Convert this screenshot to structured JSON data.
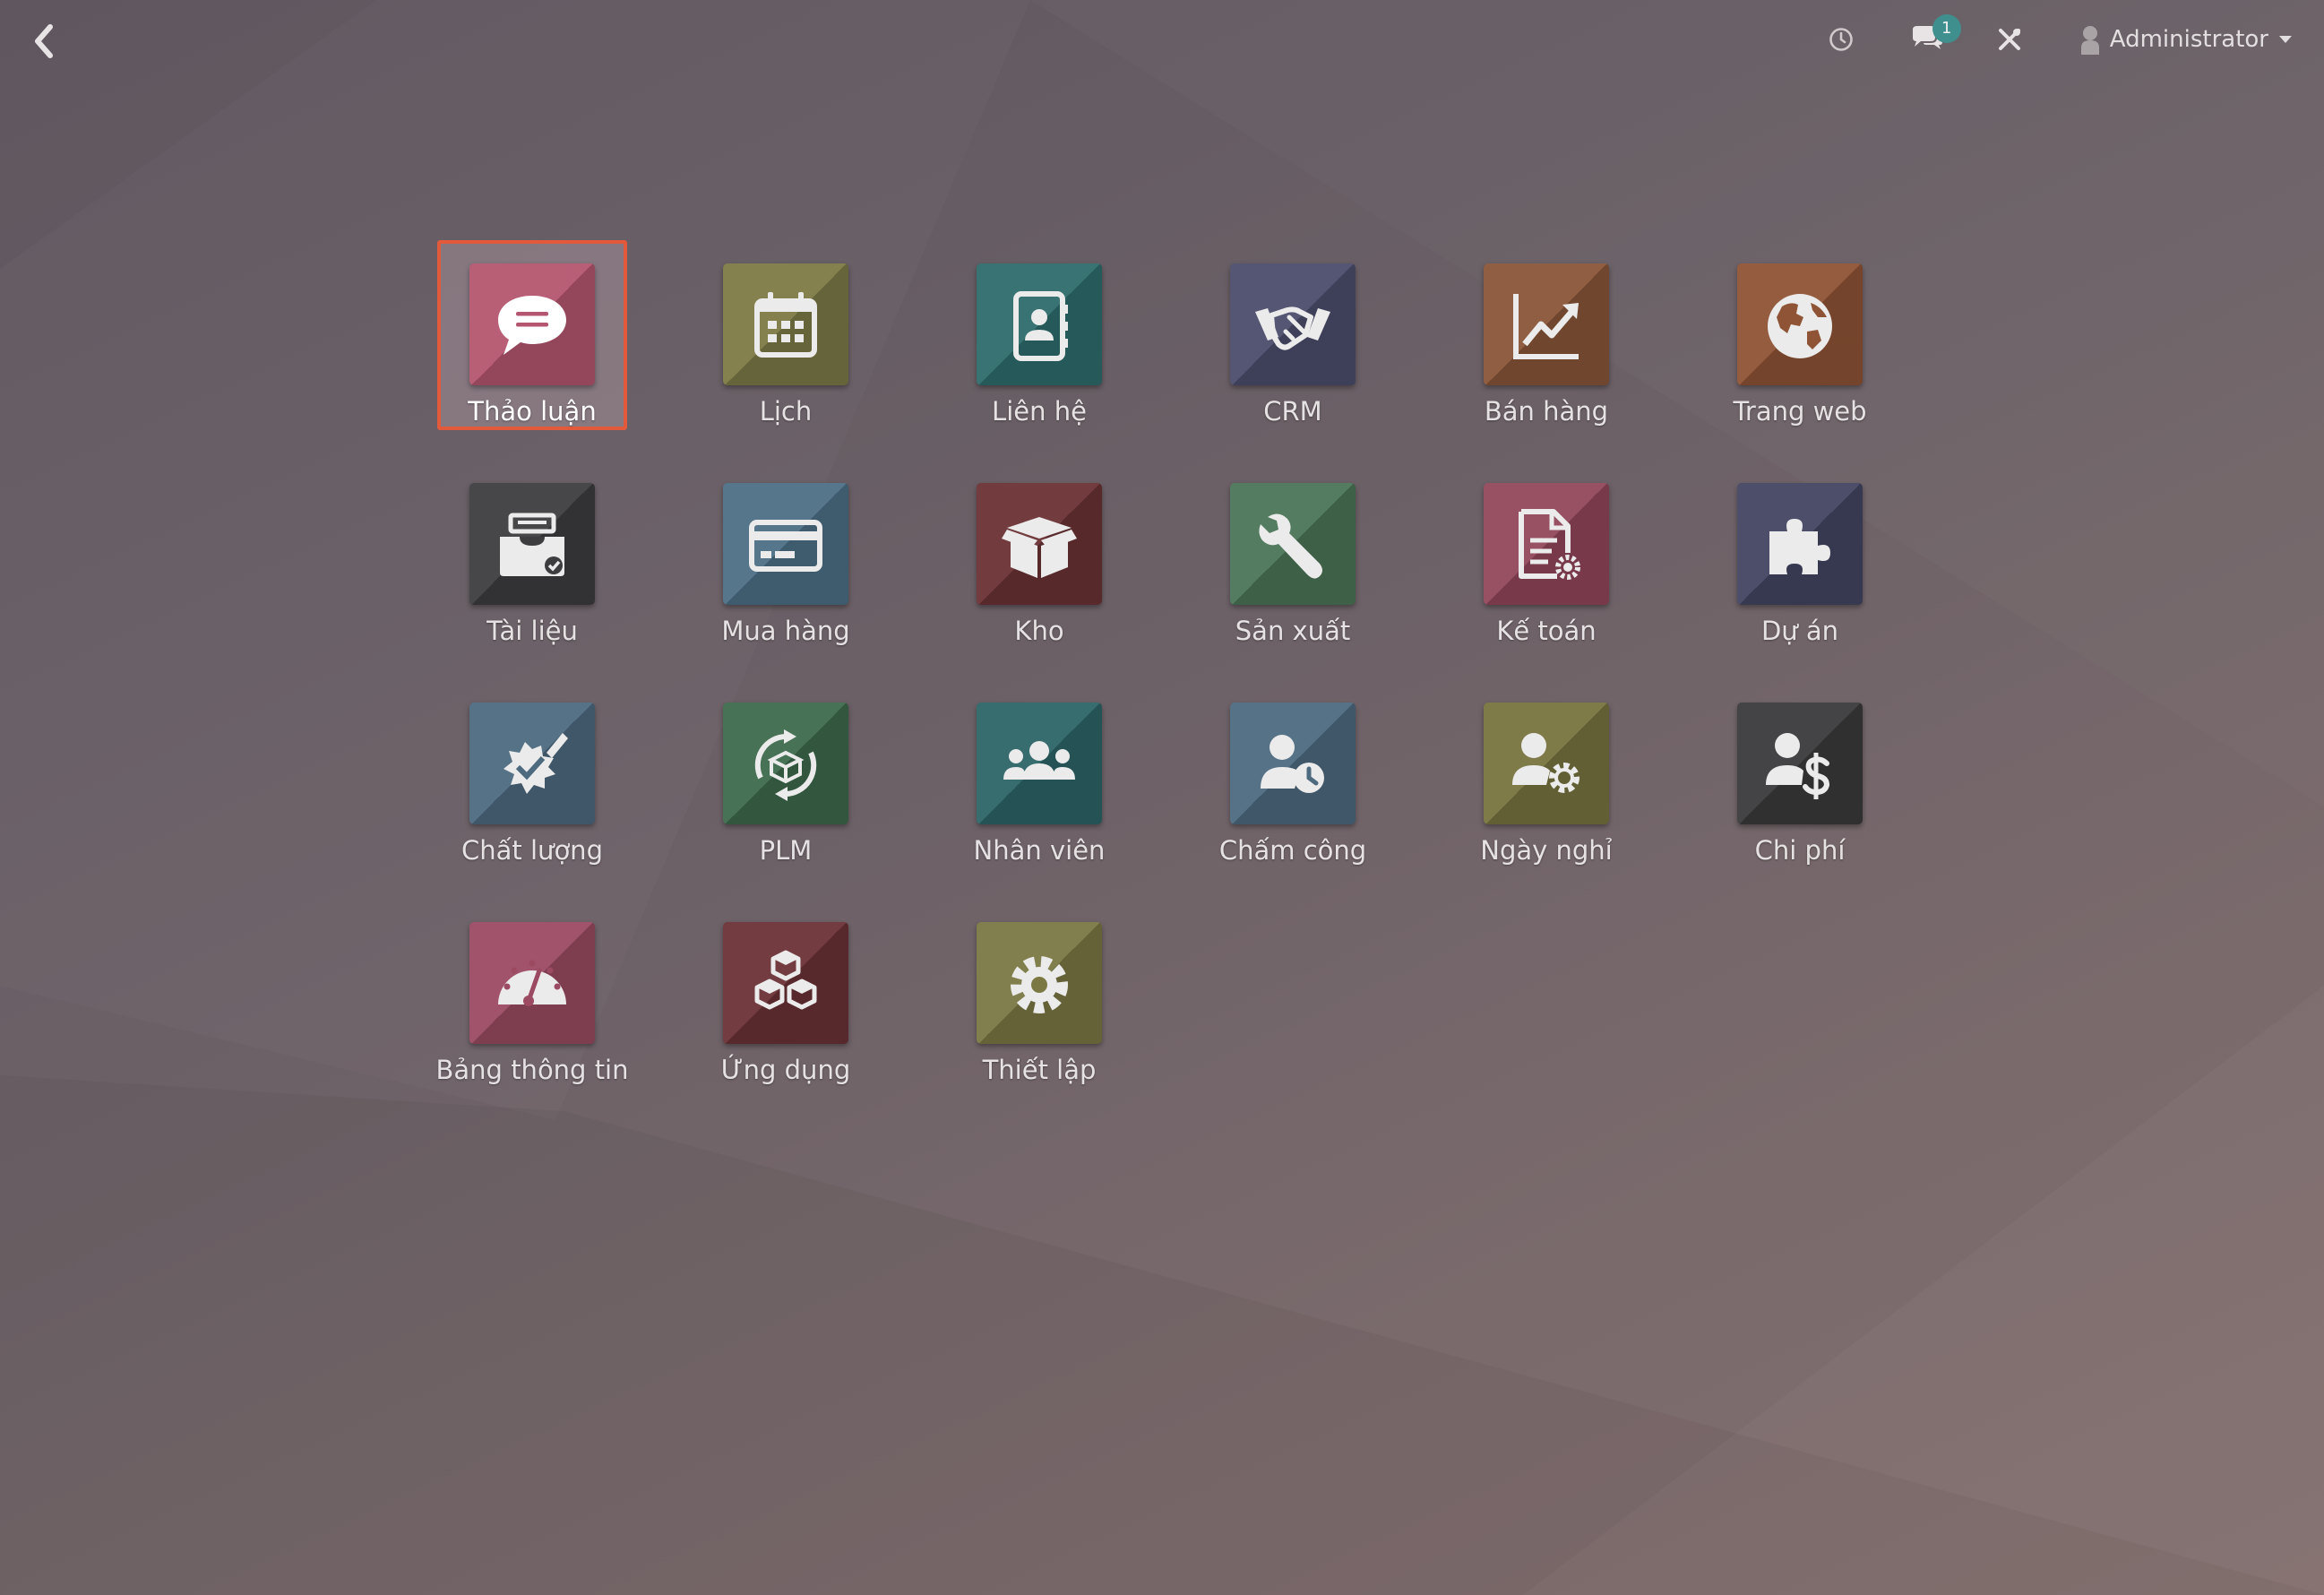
{
  "topbar": {
    "back_icon": "chevron-left-icon",
    "systray": {
      "clock_icon": "clock-icon",
      "chat_icon": "chat-bubbles-icon",
      "chat_badge": "1",
      "tools_icon": "tools-icon",
      "user_icon": "user-icon",
      "user_name": "Administrator"
    }
  },
  "apps": [
    {
      "label": "Thảo luận",
      "icon": "chat-icon",
      "color": "#b4566f",
      "selected": true
    },
    {
      "label": "Lịch",
      "icon": "calendar-icon",
      "color": "#7d7a46"
    },
    {
      "label": "Liên hệ",
      "icon": "address-book-icon",
      "color": "#2e6c6c"
    },
    {
      "label": "CRM",
      "icon": "handshake-icon",
      "color": "#4b4d6c"
    },
    {
      "label": "Bán hàng",
      "icon": "line-chart-icon",
      "color": "#8a5638"
    },
    {
      "label": "Trang web",
      "icon": "globe-icon",
      "color": "#8f5335"
    },
    {
      "label": "Tài liệu",
      "icon": "document-tray-icon",
      "color": "#3d3d3f"
    },
    {
      "label": "Mua hàng",
      "icon": "credit-card-icon",
      "color": "#4d6f86"
    },
    {
      "label": "Kho",
      "icon": "box-icon",
      "color": "#6b3234"
    },
    {
      "label": "Sản xuất",
      "icon": "wrench-icon",
      "color": "#4b7557"
    },
    {
      "label": "Kế toán",
      "icon": "invoice-gear-icon",
      "color": "#92475b"
    },
    {
      "label": "Dự án",
      "icon": "puzzle-icon",
      "color": "#434562"
    },
    {
      "label": "Chất lượng",
      "icon": "quality-seal-icon",
      "color": "#4d6a7f"
    },
    {
      "label": "PLM",
      "icon": "lifecycle-box-icon",
      "color": "#3e6a4c"
    },
    {
      "label": "Nhân viên",
      "icon": "team-icon",
      "color": "#2d6568"
    },
    {
      "label": "Chấm công",
      "icon": "user-clock-icon",
      "color": "#4d6a7f"
    },
    {
      "label": "Ngày nghỉ",
      "icon": "user-gear-icon",
      "color": "#78743f"
    },
    {
      "label": "Chi phí",
      "icon": "user-dollar-icon",
      "color": "#3a3a3c"
    },
    {
      "label": "Bảng thông tin",
      "icon": "dashboard-gauge-icon",
      "color": "#9b4a62"
    },
    {
      "label": "Ứng dụng",
      "icon": "cubes-icon",
      "color": "#6a3136"
    },
    {
      "label": "Thiết lập",
      "icon": "settings-gear-icon",
      "color": "#7b7844"
    }
  ]
}
